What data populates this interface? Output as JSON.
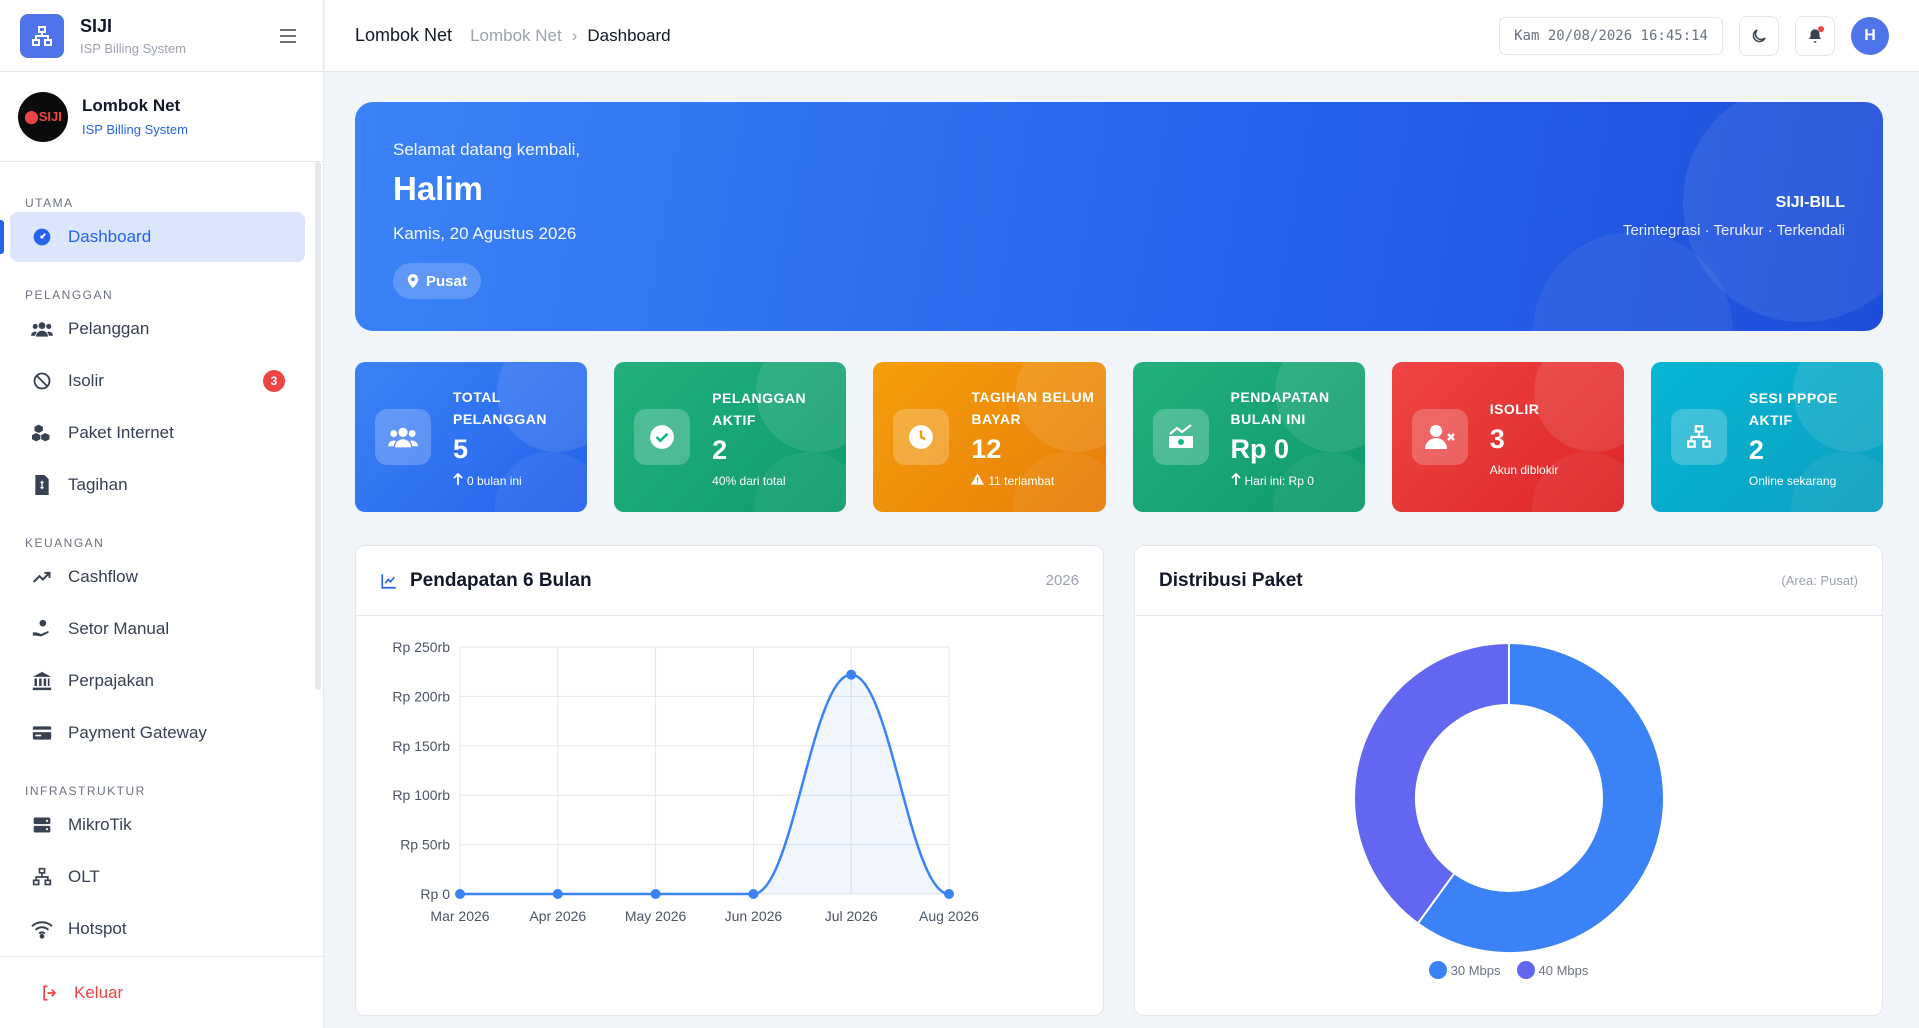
{
  "brand": {
    "title": "SIJI",
    "subtitle": "ISP Billing System"
  },
  "org": {
    "name": "Lombok Net",
    "subtitle": "ISP Billing System",
    "avatar_text": "SIJI"
  },
  "nav": {
    "sections": [
      {
        "label": "UTAMA",
        "items": [
          {
            "label": "Dashboard",
            "icon": "dashboard-icon",
            "active": true
          }
        ]
      },
      {
        "label": "PELANGGAN",
        "items": [
          {
            "label": "Pelanggan",
            "icon": "users-icon"
          },
          {
            "label": "Isolir",
            "icon": "ban-icon",
            "badge": "3"
          },
          {
            "label": "Paket Internet",
            "icon": "cubes-icon"
          },
          {
            "label": "Tagihan",
            "icon": "invoice-icon"
          }
        ]
      },
      {
        "label": "KEUANGAN",
        "items": [
          {
            "label": "Cashflow",
            "icon": "trend-icon"
          },
          {
            "label": "Setor Manual",
            "icon": "hand-coin-icon"
          },
          {
            "label": "Perpajakan",
            "icon": "bank-icon"
          },
          {
            "label": "Payment Gateway",
            "icon": "credit-card-icon"
          }
        ]
      },
      {
        "label": "INFRASTRUKTUR",
        "items": [
          {
            "label": "MikroTik",
            "icon": "server-icon"
          },
          {
            "label": "OLT",
            "icon": "network-icon"
          },
          {
            "label": "Hotspot",
            "icon": "wifi-icon"
          }
        ]
      }
    ],
    "logout": "Keluar"
  },
  "topbar": {
    "org": "Lombok Net",
    "crumb_parent": "Lombok Net",
    "crumb_current": "Dashboard",
    "clock": "Kam 20/08/2026 16:45:14",
    "avatar": "H"
  },
  "hero": {
    "greeting": "Selamat datang kembali,",
    "name": "Halim",
    "date": "Kamis, 20 Agustus 2026",
    "location": "Pusat",
    "brand": "SIJI-BILL",
    "tagline": "Terintegrasi · Terukur · Terkendali"
  },
  "stats": [
    {
      "label": "Total Pelanggan",
      "value": "5",
      "sub": "0 bulan ini",
      "sub_icon": "arrow-up-icon",
      "icon": "users-icon",
      "color": "#3b82f6"
    },
    {
      "label": "Pelanggan Aktif",
      "value": "2",
      "sub": "40% dari total",
      "icon": "check-circle-icon",
      "color": "#10b981"
    },
    {
      "label": "Tagihan Belum Bayar",
      "value": "12",
      "sub": "11 terlambat",
      "sub_icon": "warning-icon",
      "icon": "clock-icon",
      "color": "#f59e0b"
    },
    {
      "label": "Pendapatan Bulan Ini",
      "value": "Rp 0",
      "sub": "Hari ini: Rp 0",
      "sub_icon": "arrow-up-icon",
      "icon": "money-chart-icon",
      "color": "#10b981"
    },
    {
      "label": "Isolir",
      "value": "3",
      "sub": "Akun diblokir",
      "icon": "user-x-icon",
      "color": "#ef4444"
    },
    {
      "label": "Sesi PPPoE Aktif",
      "value": "2",
      "sub": "Online sekarang",
      "icon": "network-icon",
      "color": "#06b6d4"
    }
  ],
  "line_card": {
    "title": "Pendapatan 6 Bulan",
    "meta": "2026"
  },
  "pie_card": {
    "title": "Distribusi Paket",
    "meta": "(Area: Pusat)"
  },
  "chart_data": [
    {
      "type": "area",
      "title": "Pendapatan 6 Bulan",
      "categories": [
        "Mar 2026",
        "Apr 2026",
        "May 2026",
        "Jun 2026",
        "Jul 2026",
        "Aug 2026"
      ],
      "values": [
        0,
        0,
        0,
        0,
        222000,
        0
      ],
      "yticks": [
        "Rp 0",
        "Rp 50rb",
        "Rp 100rb",
        "Rp 150rb",
        "Rp 200rb",
        "Rp 250rb"
      ],
      "ylim": [
        0,
        250000
      ],
      "grid": true,
      "color": "#3b82f6"
    },
    {
      "type": "pie",
      "title": "Distribusi Paket",
      "labels": [
        "30 Mbps",
        "40 Mbps"
      ],
      "values": [
        3,
        2
      ],
      "colors": [
        "#3b82f6",
        "#6366f1"
      ],
      "legend": "bottom"
    }
  ]
}
